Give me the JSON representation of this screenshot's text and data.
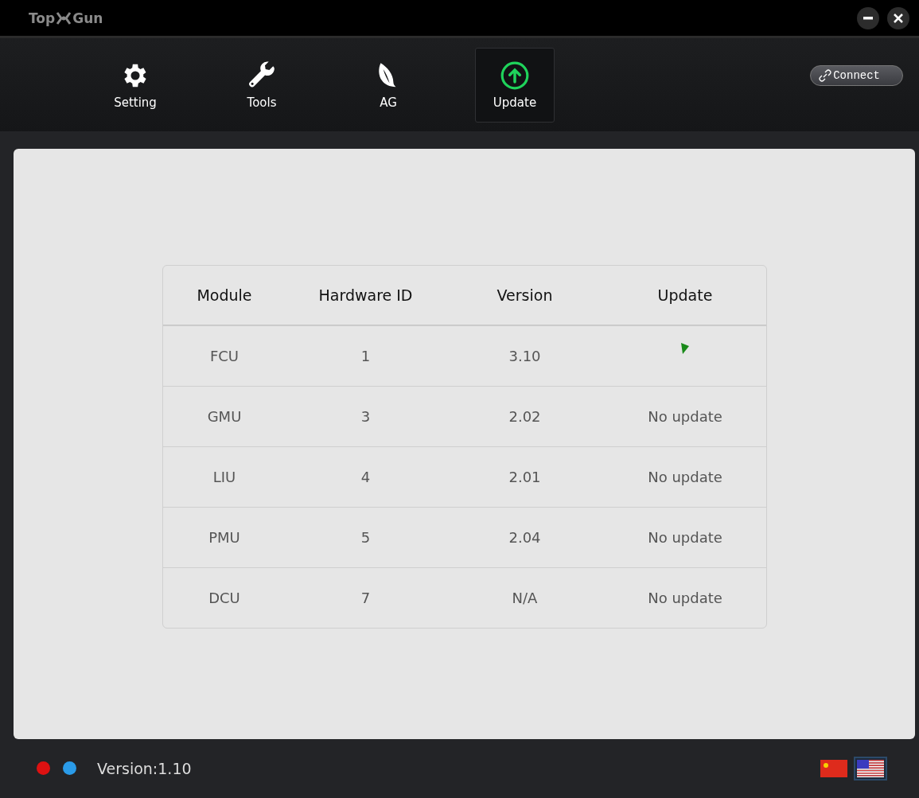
{
  "window": {
    "logo_left": "Top",
    "logo_right": "Gun"
  },
  "nav": [
    {
      "label": "Setting",
      "kind": "gear",
      "selected": false
    },
    {
      "label": "Tools",
      "kind": "wrench",
      "selected": false
    },
    {
      "label": "AG",
      "kind": "leaf",
      "selected": false
    },
    {
      "label": "Update",
      "kind": "upload",
      "selected": true
    }
  ],
  "connect_button": "Connect",
  "table": {
    "columns": [
      "Module",
      "Hardware ID",
      "Version",
      "Update"
    ],
    "rows": [
      {
        "cells": [
          "FCU",
          "1",
          "3.10"
        ],
        "update": {
          "kind": "flag"
        }
      },
      {
        "cells": [
          "GMU",
          "3",
          "2.02"
        ],
        "update": {
          "kind": "text",
          "text": "No update"
        }
      },
      {
        "cells": [
          "LIU",
          "4",
          "2.01"
        ],
        "update": {
          "kind": "text",
          "text": "No update"
        }
      },
      {
        "cells": [
          "PMU",
          "5",
          "2.04"
        ],
        "update": {
          "kind": "text",
          "text": "No update"
        }
      },
      {
        "cells": [
          "DCU",
          "7",
          "N/A"
        ],
        "update": {
          "kind": "text",
          "text": "No update"
        }
      }
    ]
  },
  "status_bar": {
    "lights": [
      {
        "color": "#dd1111"
      },
      {
        "color": "#2a9be8"
      }
    ],
    "version": "Version:1.10",
    "languages": [
      {
        "kind": "cn",
        "selected": false
      },
      {
        "kind": "us",
        "selected": true
      }
    ]
  }
}
